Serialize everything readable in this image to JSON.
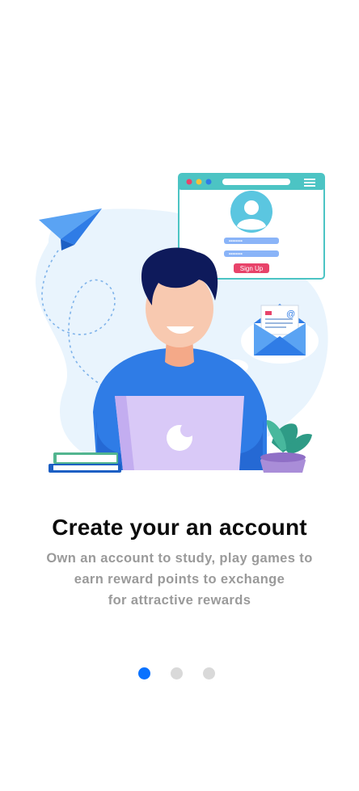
{
  "onboarding": {
    "title": "Create your an account",
    "description_lines": [
      "Own an account to study, play games to",
      "earn reward points to exchange",
      "for attractive rewards"
    ],
    "pager": {
      "total_pages": 3,
      "current_page": 1
    },
    "illustration": {
      "signup_button_label": "Sign Up",
      "email_at_symbol": "@"
    }
  },
  "colors": {
    "accent": "#0a72ff",
    "dot_inactive": "#d9d9d9",
    "title": "#0b0b0b",
    "description": "#9a9a9a",
    "signup_button": "#e8436a",
    "window_teal": "#4cc4c4"
  }
}
